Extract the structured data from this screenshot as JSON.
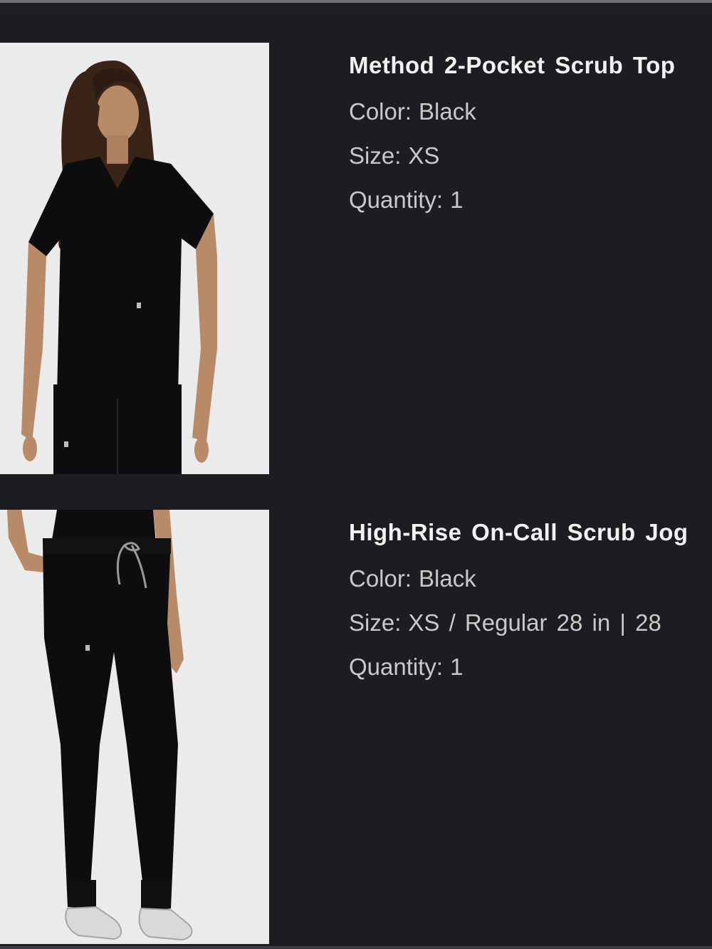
{
  "items": [
    {
      "title": "Method 2-Pocket Scrub Top",
      "color_label": "Color:",
      "color_value": "Black",
      "size_label": "Size:",
      "size_value": "XS",
      "quantity_label": "Quantity:",
      "quantity_value": "1",
      "image_subject": "model-wearing-black-scrub-top"
    },
    {
      "title": "High-Rise On-Call Scrub Jog",
      "color_label": "Color:",
      "color_value": "Black",
      "size_label": "Size:",
      "size_value": "XS / Regular 28 in | 28",
      "quantity_label": "Quantity:",
      "quantity_value": "1",
      "image_subject": "model-wearing-black-scrub-joggers"
    }
  ],
  "colors": {
    "background": "#1c1d21",
    "title_text": "#f2f2f2",
    "meta_text": "#c9c9c9",
    "photo_background": "#ececec",
    "garment": "#0d0d0f"
  }
}
